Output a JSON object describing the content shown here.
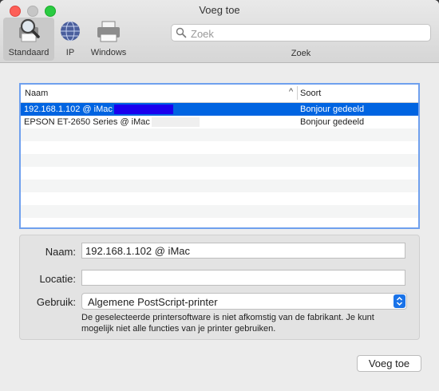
{
  "window": {
    "title": "Voeg toe"
  },
  "toolbar": {
    "items": [
      {
        "label": "Standaard",
        "icon": "printer-search-icon",
        "selected": true
      },
      {
        "label": "IP",
        "icon": "globe-icon"
      },
      {
        "label": "Windows",
        "icon": "printer-icon"
      }
    ],
    "search_placeholder": "Zoek",
    "search_caption": "Zoek"
  },
  "printer_list": {
    "col_name": "Naam",
    "col_type": "Soort",
    "sort_indicator": "^",
    "rows": [
      {
        "name": "192.168.1.102 @ iMac",
        "type": "Bonjour gedeeld",
        "selected": true
      },
      {
        "name": "EPSON ET-2650 Series @ iMac",
        "type": "Bonjour gedeeld"
      }
    ]
  },
  "form": {
    "name_label": "Naam:",
    "name_value": "192.168.1.102 @ iMac",
    "location_label": "Locatie:",
    "location_value": "",
    "use_label": "Gebruik:",
    "use_value": "Algemene PostScript-printer",
    "note": "De geselecteerde printersoftware is niet afkomstig van de fabrikant. Je kunt mogelijk niet alle functies van je printer gebruiken."
  },
  "add_button_label": "Voeg toe",
  "colors": {
    "selection": "#0064e1",
    "focus_ring": "#6fa0ee",
    "popup_accent": "#1a73e8"
  }
}
